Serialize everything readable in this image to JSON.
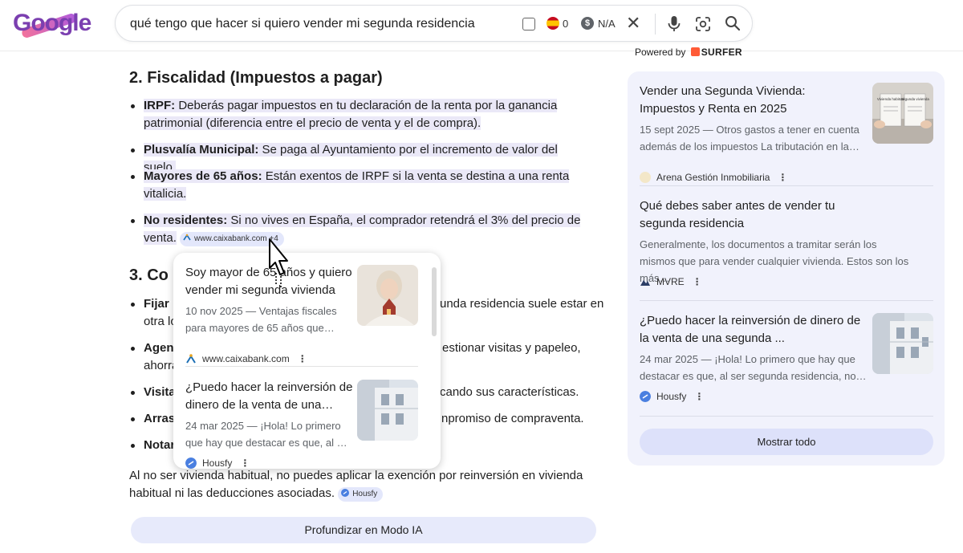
{
  "header": {
    "logo_text": "Google",
    "search_query": "qué tengo que hacer si quiero vender mi segunda residencia",
    "extension_count": "0",
    "extension_value": "N/A",
    "powered_by": "Powered by",
    "powered_brand": "SURFER"
  },
  "main": {
    "section2_title": "2. Fiscalidad (Impuestos a pagar)",
    "bullets": [
      {
        "label": "IRPF:",
        "text": " Deberás pagar impuestos en tu declaración de la renta por la ganancia patrimonial (diferencia entre el precio de venta y el de compra)."
      },
      {
        "label": "Plusvalía Municipal:",
        "text": " Se paga al Ayuntamiento por el incremento de valor del suelo."
      },
      {
        "label": "Mayores de 65 años:",
        "text": " Están exentos de IRPF si la venta se destina a una renta vitalicia."
      },
      {
        "label": "No residentes:",
        "text": " Si no vives en España, el comprador retendrá el 3% del precio de venta.",
        "chip": "www.caixabank.com +4"
      }
    ],
    "section3_title": "3. Co",
    "section3_items": [
      {
        "label": "Fijar",
        "text_right": "unda residencia suele estar en",
        "text_line2": "otra lo"
      },
      {
        "label": "Agen",
        "text_right": "estionar visitas y papeleo,",
        "text_line2": "ahorra"
      },
      {
        "label": "Visita",
        "text_right": "cando sus características."
      },
      {
        "label": "Arras",
        "text_right": "npromiso de compraventa."
      },
      {
        "label": "Notar",
        "text_right": ""
      }
    ],
    "closing_para": "Al no ser vivienda habitual, no puedes aplicar la exención por reinversión en vivienda habitual ni las deducciones asociadas.",
    "closing_chip": "Housfy",
    "deep_button": "Profundizar en Modo IA"
  },
  "popup": {
    "cards": [
      {
        "title": "Soy mayor de 65 años y quiero vender mi segunda vivienda",
        "snippet": "10 nov 2025 — Ventajas fiscales para mayores de 65 años que…",
        "source": "www.caixabank.com"
      },
      {
        "title": "¿Puedo hacer la reinversión de dinero de la venta de una…",
        "snippet": "24 mar 2025 — ¡Hola! Lo primero que hay que destacar es que, al …",
        "source": "Housfy"
      }
    ]
  },
  "sources_panel": {
    "cards": [
      {
        "title": "Vender una Segunda Vivienda: Impuestos y Renta en 2025",
        "snippet": "15 sept 2025 — Otros gastos a tener en cuenta además de los impuestos La tributación en la…",
        "source": "Arena Gestión Inmobiliaria",
        "thumb_left": "Vivienda habitual",
        "thumb_right": "Segunda vivienda"
      },
      {
        "title": "Qué debes saber antes de vender tu segunda residencia",
        "snippet": "Generalmente, los documentos a tramitar serán los mismos que para vender cualquier vivienda. Estos son los más…",
        "source": "MVRE"
      },
      {
        "title": "¿Puedo hacer la reinversión de dinero de la venta de una segunda ...",
        "snippet": "24 mar 2025 — ¡Hola! Lo primero que hay que destacar es que, al ser segunda residencia, no…",
        "source": "Housfy"
      }
    ],
    "show_all": "Mostrar todo"
  }
}
